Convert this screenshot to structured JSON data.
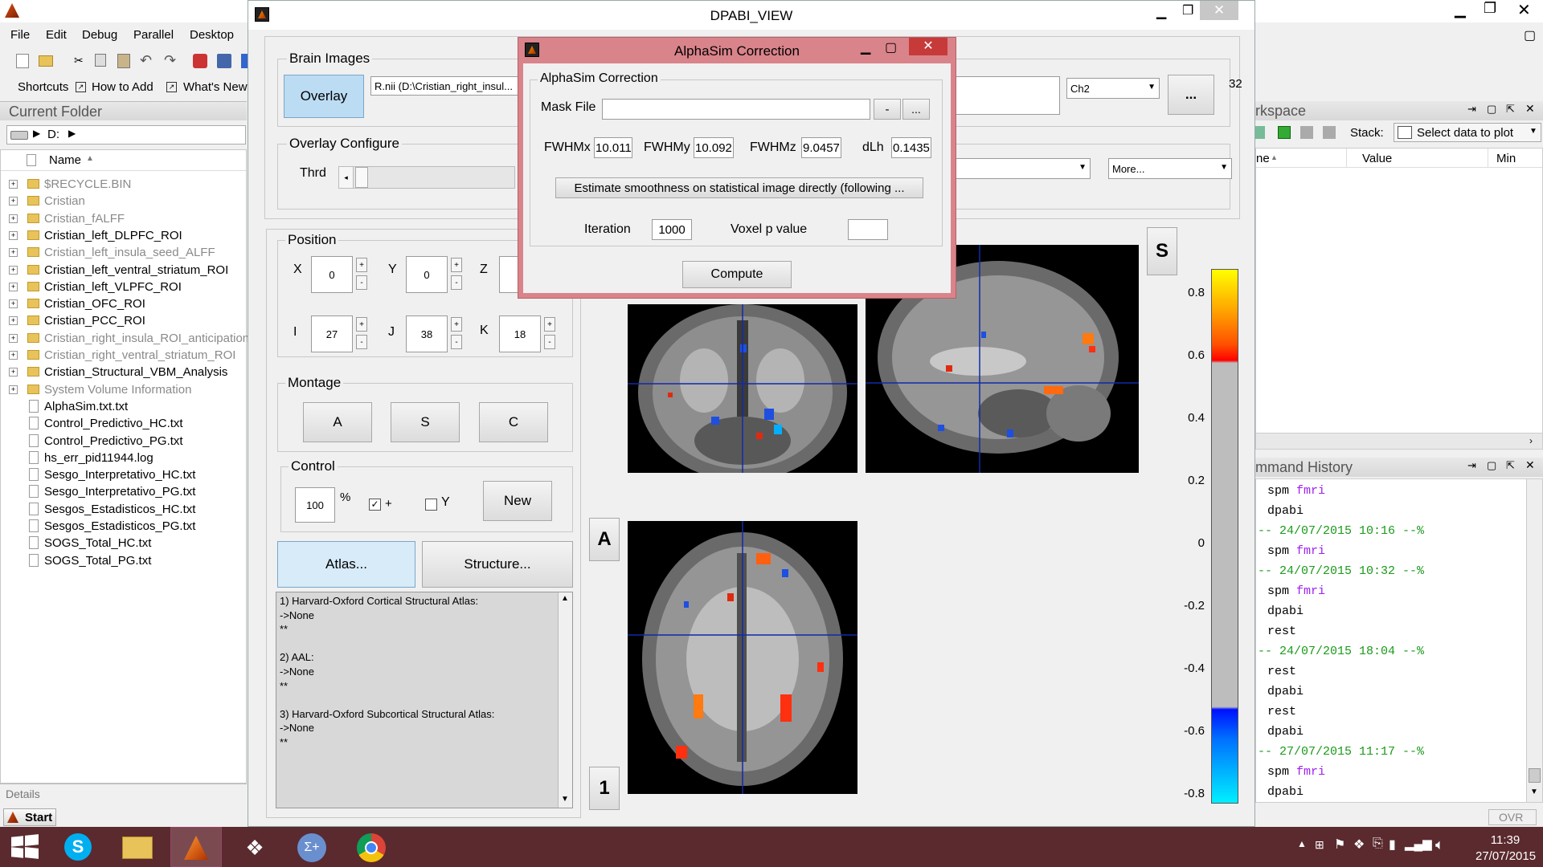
{
  "matlab": {
    "menu": [
      "File",
      "Edit",
      "Debug",
      "Parallel",
      "Desktop"
    ],
    "shortcuts": [
      "Shortcuts",
      "How to Add",
      "What's New"
    ],
    "current_folder_title": "Current Folder",
    "path": "D:",
    "name_header": "Name",
    "files": [
      {
        "name": "$RECYCLE.BIN",
        "type": "folder",
        "grey": true
      },
      {
        "name": "Cristian",
        "type": "folder",
        "grey": true
      },
      {
        "name": "Cristian_fALFF",
        "type": "folder",
        "grey": true
      },
      {
        "name": "Cristian_left_DLPFC_ROI",
        "type": "folder",
        "grey": false
      },
      {
        "name": "Cristian_left_insula_seed_ALFF",
        "type": "folder",
        "grey": true
      },
      {
        "name": "Cristian_left_ventral_striatum_ROI",
        "type": "folder",
        "grey": false
      },
      {
        "name": "Cristian_left_VLPFC_ROI",
        "type": "folder",
        "grey": false
      },
      {
        "name": "Cristian_OFC_ROI",
        "type": "folder",
        "grey": false
      },
      {
        "name": "Cristian_PCC_ROI",
        "type": "folder",
        "grey": false
      },
      {
        "name": "Cristian_right_insula_ROI_anticipation",
        "type": "folder",
        "grey": true
      },
      {
        "name": "Cristian_right_ventral_striatum_ROI",
        "type": "folder",
        "grey": true
      },
      {
        "name": "Cristian_Structural_VBM_Analysis",
        "type": "folder",
        "grey": false
      },
      {
        "name": "System Volume Information",
        "type": "folder",
        "grey": true
      },
      {
        "name": "AlphaSim.txt.txt",
        "type": "file",
        "grey": false
      },
      {
        "name": "Control_Predictivo_HC.txt",
        "type": "file",
        "grey": false
      },
      {
        "name": "Control_Predictivo_PG.txt",
        "type": "file",
        "grey": false
      },
      {
        "name": "hs_err_pid11944.log",
        "type": "file",
        "grey": false
      },
      {
        "name": "Sesgo_Interpretativo_HC.txt",
        "type": "file",
        "grey": false
      },
      {
        "name": "Sesgo_Interpretativo_PG.txt",
        "type": "file",
        "grey": false
      },
      {
        "name": "Sesgos_Estadisticos_HC.txt",
        "type": "file",
        "grey": false
      },
      {
        "name": "Sesgos_Estadisticos_PG.txt",
        "type": "file",
        "grey": false
      },
      {
        "name": "SOGS_Total_HC.txt",
        "type": "file",
        "grey": false
      },
      {
        "name": "SOGS_Total_PG.txt",
        "type": "file",
        "grey": false
      }
    ],
    "details": "Details",
    "start": "Start",
    "ovr": "OVR",
    "workspace_title": "rkspace",
    "stack_label": "Stack:",
    "select_data": "Select data to plot",
    "ws_cols": [
      "ne",
      "Value",
      "Min"
    ],
    "history_title": "mmand History",
    "history": [
      {
        "text": "spm ",
        "kw": "fmri",
        "type": "cmd"
      },
      {
        "text": "dpabi",
        "kw": "",
        "type": "cmd"
      },
      {
        "text": "-- 24/07/2015 10:16 --%",
        "kw": "",
        "type": "sep"
      },
      {
        "text": "spm ",
        "kw": "fmri",
        "type": "cmd"
      },
      {
        "text": "-- 24/07/2015 10:32 --%",
        "kw": "",
        "type": "sep"
      },
      {
        "text": "spm ",
        "kw": "fmri",
        "type": "cmd"
      },
      {
        "text": "dpabi",
        "kw": "",
        "type": "cmd"
      },
      {
        "text": "rest",
        "kw": "",
        "type": "cmd"
      },
      {
        "text": "-- 24/07/2015 18:04 --%",
        "kw": "",
        "type": "sep"
      },
      {
        "text": "rest",
        "kw": "",
        "type": "cmd"
      },
      {
        "text": "dpabi",
        "kw": "",
        "type": "cmd"
      },
      {
        "text": "rest",
        "kw": "",
        "type": "cmd"
      },
      {
        "text": "dpabi",
        "kw": "",
        "type": "cmd"
      },
      {
        "text": "-- 27/07/2015 11:17 --%",
        "kw": "",
        "type": "sep"
      },
      {
        "text": "spm ",
        "kw": "fmri",
        "type": "cmd"
      },
      {
        "text": "dpabi",
        "kw": "",
        "type": "cmd"
      }
    ]
  },
  "dpabi": {
    "title": "DPABI_VIEW",
    "brain_images": "Brain Images",
    "overlay_btn": "Overlay",
    "overlay_file": "R.nii (D:\\Cristian_right_insul...",
    "ch_select": "Ch2",
    "ellipsis": "...",
    "count": "32",
    "overlay_config": "Overlay Configure",
    "thrd": "Thrd",
    "more": "More...",
    "position": "Position",
    "x_label": "X",
    "x_val": "0",
    "y_label": "Y",
    "y_val": "0",
    "z_label": "Z",
    "i_label": "I",
    "i_val": "27",
    "j_label": "J",
    "j_val": "38",
    "k_label": "K",
    "k_val": "18",
    "montage": "Montage",
    "montage_a": "A",
    "montage_s": "S",
    "montage_c": "C",
    "control": "Control",
    "pct_val": "100",
    "pct": "%",
    "plus_label": "+",
    "y_check": "Y",
    "new_btn": "New",
    "atlas_btn": "Atlas...",
    "structure_btn": "Structure...",
    "atlas_text": [
      "1) Harvard-Oxford Cortical Structural Atlas:",
      "->None",
      "**",
      "",
      "2) AAL:",
      "->None",
      "**",
      "",
      "3) Harvard-Oxford Subcortical Structural Atlas:",
      "->None",
      "**"
    ],
    "view_s": "S",
    "view_a": "A",
    "view_1": "1",
    "colorbar_ticks": [
      "0.8",
      "0.6",
      "0.4",
      "0.2",
      "0",
      "-0.2",
      "-0.4",
      "-0.6",
      "-0.8"
    ]
  },
  "alphasim": {
    "title": "AlphaSim Correction",
    "group": "AlphaSim Correction",
    "mask_label": "Mask File",
    "mask_value": "",
    "minus": "-",
    "browse": "...",
    "fwhmx_label": "FWHMx",
    "fwhmx": "10.011",
    "fwhmy_label": "FWHMy",
    "fwhmy": "10.092",
    "fwhmz_label": "FWHMz",
    "fwhmz": "9.0457",
    "dlh_label": "dLh",
    "dlh": "0.1435",
    "estimate_btn": "Estimate smoothness on statistical image directly (following ...",
    "iteration_label": "Iteration",
    "iteration": "1000",
    "voxel_label": "Voxel p value",
    "voxel": "",
    "compute": "Compute"
  },
  "taskbar": {
    "time": "11:39",
    "date": "27/07/2015"
  },
  "colors": {
    "dialog_border": "#d9838a",
    "overlay_btn_bg": "#bcdcf4",
    "taskbar": "#5a2a2e"
  }
}
